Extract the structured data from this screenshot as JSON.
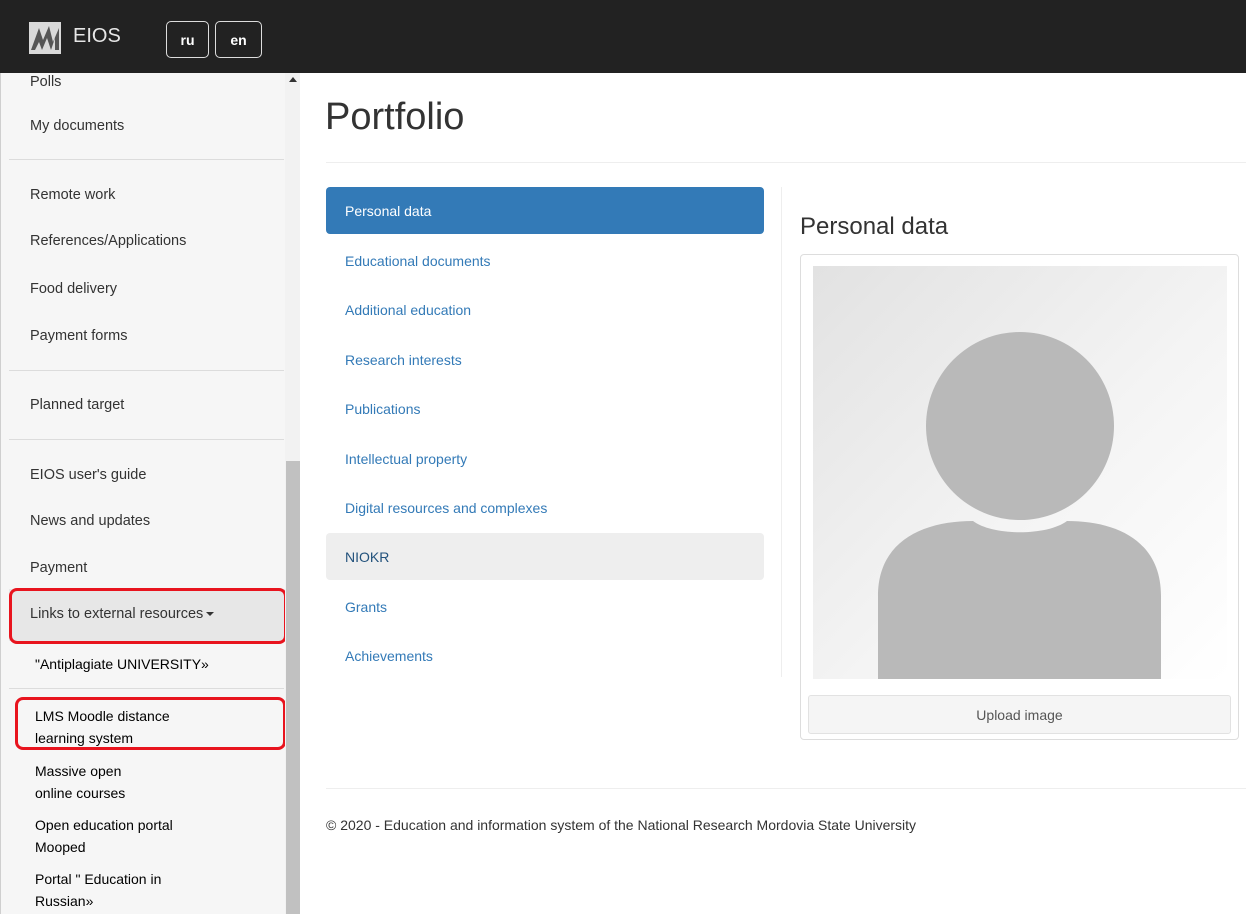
{
  "navbar": {
    "brand": "EIOS",
    "languages": [
      "ru",
      "en"
    ]
  },
  "sidebar": {
    "items": [
      "Polls",
      "My documents",
      "Remote work",
      "References/Applications",
      "Food delivery",
      "Payment forms",
      "Planned target",
      "EIOS user's guide",
      "News and updates",
      "Payment"
    ],
    "dropdown_label": "Links to external resources",
    "external_links": [
      {
        "line1": "\"Antiplagiate UNIVERSITY»",
        "line2": ""
      },
      {
        "line1": "LMS Moodle distance",
        "line2": "learning system"
      },
      {
        "line1": "Massive open",
        "line2": "online courses"
      },
      {
        "line1": "Open education portal",
        "line2": "Mooped"
      },
      {
        "line1": "Portal \" Education in",
        "line2": "Russian»"
      }
    ]
  },
  "page": {
    "title": "Portfolio",
    "tabs": [
      "Personal data",
      "Educational documents",
      "Additional education",
      "Research interests",
      "Publications",
      "Intellectual property",
      "Digital resources and complexes",
      "NIOKR",
      "Grants",
      "Achievements"
    ],
    "active_tab": "Personal data",
    "section_title": "Personal data",
    "upload_label": "Upload image"
  },
  "footer": {
    "text": "© 2020 - Education and information system of the National Research Mordovia State University"
  },
  "colors": {
    "navbar": "#222222",
    "accent": "#337ab7",
    "highlight": "#e8141e"
  }
}
